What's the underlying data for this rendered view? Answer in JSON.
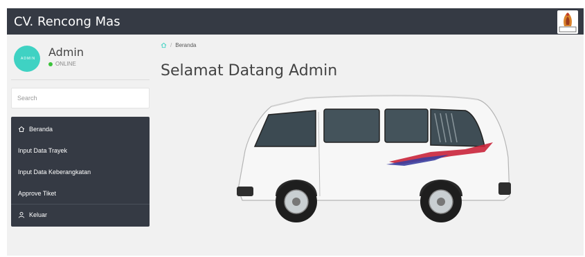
{
  "app": {
    "brand": "CV. Rencong Mas"
  },
  "user": {
    "name": "Admin",
    "status": "ONLINE",
    "avatar_text": "ADMIN"
  },
  "search": {
    "placeholder": "Search",
    "value": ""
  },
  "menu": {
    "items": [
      {
        "label": "Beranda",
        "icon": "home-icon"
      },
      {
        "label": "Input Data Trayek"
      },
      {
        "label": "Input Data Keberangkatan"
      },
      {
        "label": "Approve Tiket"
      },
      {
        "label": "Keluar",
        "icon": "user-icon"
      }
    ]
  },
  "breadcrumb": {
    "separator": "/",
    "current": "Beranda"
  },
  "main": {
    "title": "Selamat Datang Admin"
  },
  "colors": {
    "topbar": "#353a44",
    "sidebar_menu": "#353a44",
    "avatar": "#3fd2c3",
    "online": "#3bc23b",
    "background": "#f1f1f1"
  }
}
